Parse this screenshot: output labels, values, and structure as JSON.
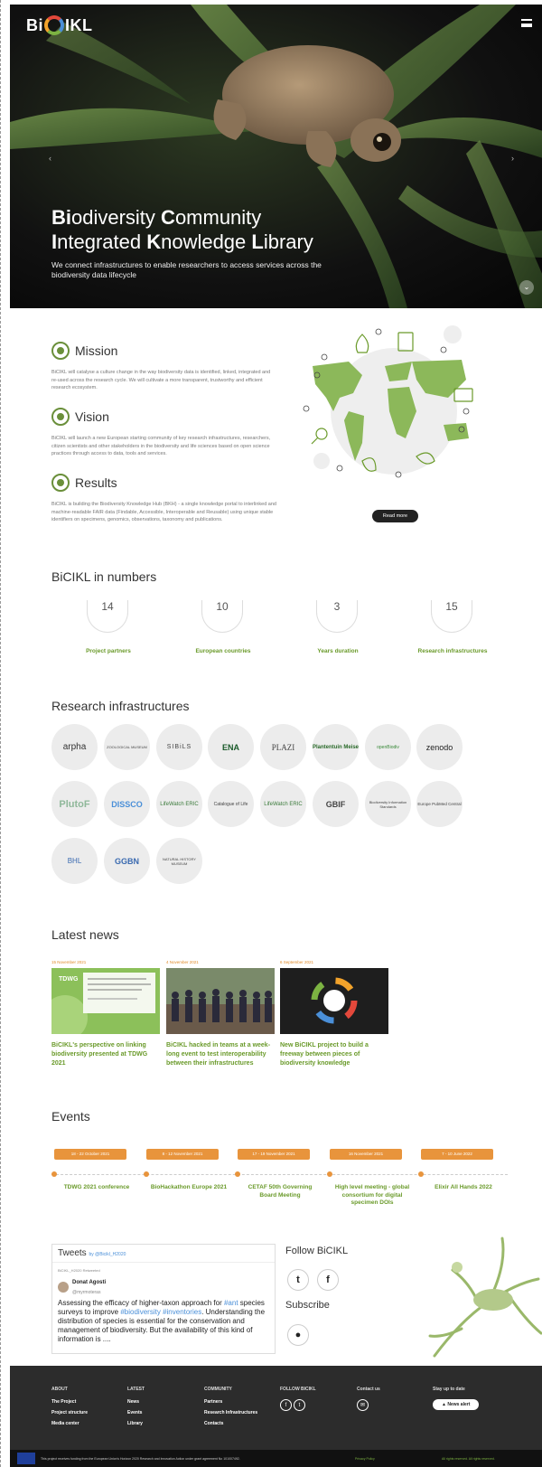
{
  "hero": {
    "logo": "BiCIKL",
    "title_line1_prefix": "Bi",
    "title_line1_rest": "odiversity ",
    "title_line1_c": "C",
    "title_line1_rest2": "ommunity",
    "title_line2_i": "I",
    "title_line2_rest": "ntegrated ",
    "title_line2_k": "K",
    "title_line2_rest2": "nowledge ",
    "title_line2_l": "L",
    "title_line2_rest3": "ibrary",
    "subtitle": "We connect infrastructures to enable researchers to access services across the biodiversity data lifecycle"
  },
  "about": {
    "mission_title": "Mission",
    "mission_text": "BiCIKL will catalyse a culture change in the way biodiversity data is identified, linked, integrated and re-used across the research cycle. We will cultivate a more transparent, trustworthy and efficient research ecosystem.",
    "vision_title": "Vision",
    "vision_text": "BiCIKL will launch a new European starting community of key research infrastructures, researchers, citizen scientists and other stakeholders in the biodiversity and life sciences based on open science practices through access to data, tools and services.",
    "results_title": "Results",
    "results_text": "BiCIKL is building the Biodiversity Knowledge Hub (BKH) - a single knowledge portal to interlinked and machine-readable FAIR data (Findable, Accessible, Interoperable and Reusable) using unique stable identifiers on specimens, genomics, observations, taxonomy and publications.",
    "read_more": "Read more"
  },
  "numbers": {
    "title": "BiCIKL in numbers",
    "items": [
      {
        "value": "14",
        "label": "Project partners"
      },
      {
        "value": "10",
        "label": "European countries"
      },
      {
        "value": "3",
        "label": "Years duration"
      },
      {
        "value": "15",
        "label": "Research infrastructures"
      }
    ]
  },
  "infra": {
    "title": "Research infrastructures",
    "logos": [
      "arpha",
      "ZOOLOGICAL MUSEUM",
      "SIBiLS",
      "ENA",
      "PLAZI",
      "Plantentuin Meise",
      "openBiodiv",
      "zenodo",
      "PlutoF",
      "DISSCO",
      "LifeWatch ERIC",
      "Catalogue of Life",
      "LifeWatch ERIC",
      "GBIF",
      "Biodiversity Information Standards",
      "Europe PubMed Central",
      "BHL",
      "GGBN",
      "NATURAL HISTORY MUSEUM"
    ]
  },
  "news": {
    "title": "Latest news",
    "items": [
      {
        "date": "15 November 2021",
        "title": "BiCIKL's perspective on linking biodiversity presented at TDWG 2021"
      },
      {
        "date": "4 November 2021",
        "title": "BiCIKL hacked in teams at a week-long event to test interoperability between their infrastructures"
      },
      {
        "date": "6 September 2021",
        "title": "New BiCIKL project to build a freeway between pieces of biodiversity knowledge"
      }
    ]
  },
  "events": {
    "title": "Events",
    "items": [
      {
        "date": "18 - 22 October 2021",
        "title": "TDWG 2021 conference"
      },
      {
        "date": "8 - 12 November 2021",
        "title": "BioHackathon Europe 2021"
      },
      {
        "date": "17 - 19 November 2021",
        "title": "CETAF 50th Governing Board Meeting"
      },
      {
        "date": "16 November 2021",
        "title": "High level meeting - global consortium for digital specimen DOIs"
      },
      {
        "date": "7 - 10 June 2022",
        "title": "Elixir All Hands 2022"
      }
    ]
  },
  "tweets": {
    "heading": "Tweets",
    "by": "by @Bicikl_H2020",
    "retweet": "BiCIKL_H2020 Retweeted",
    "author": "Donat Agosti",
    "handle": "@myrmoteras",
    "text_a": "Assessing the efficacy of higher-taxon approach for ",
    "hash1": "#ant",
    "text_b": " species surveys to improve ",
    "hash2": "#biodiversity",
    "hash3": "#inventories",
    "text_c": ". Understanding the distribution of species is essential for the conservation and management of biodiversity. But the availability of this kind of information is ...."
  },
  "social": {
    "follow_title": "Follow BiCIKL",
    "subscribe_title": "Subscribe"
  },
  "footer": {
    "about": {
      "heading": "ABOUT",
      "links": [
        "The Project",
        "Project structure",
        "Media center"
      ]
    },
    "latest": {
      "heading": "LATEST",
      "links": [
        "News",
        "Events",
        "Library"
      ]
    },
    "community": {
      "heading": "COMMUNITY",
      "links": [
        "Partners",
        "Research Infrastructures",
        "Contacts"
      ]
    },
    "follow": {
      "heading": "FOLLOW BICIKL"
    },
    "contact": {
      "heading": "Contact us"
    },
    "stay": {
      "heading": "Stay up to date",
      "button": "News alert"
    },
    "funding": "This project receives funding from the European Union's Horizon 2020 Research and Innovation Action under grant agreement No 101007492.",
    "privacy": "Privacy Policy",
    "rights": "All rights reserved. All rights reserved."
  },
  "colors": {
    "accent_green": "#6a9a2a",
    "accent_orange": "#e8943c",
    "footer_bg": "#2c2c2c"
  }
}
